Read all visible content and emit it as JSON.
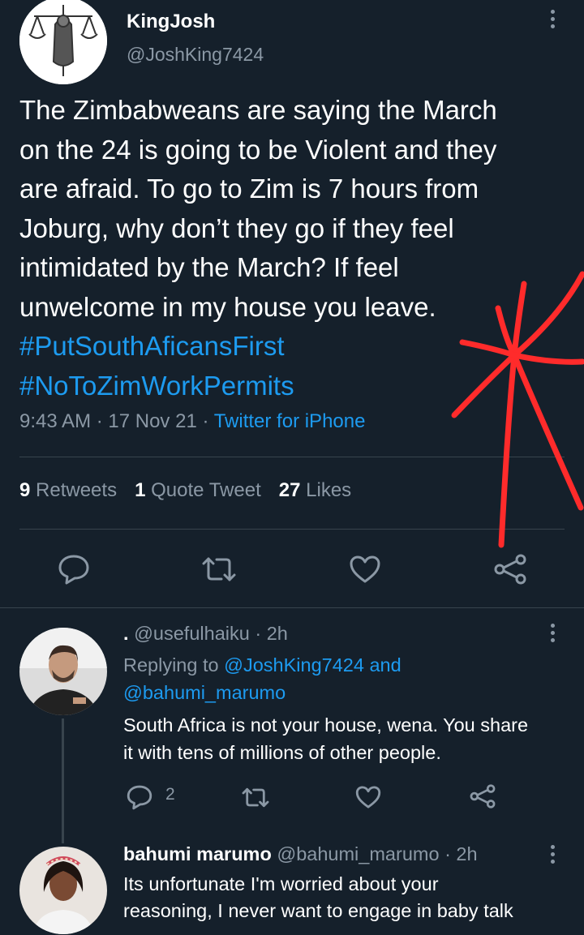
{
  "tweet": {
    "author_name": "KingJosh",
    "author_handle": "@JoshKing7424",
    "text": "The Zimbabweans are saying the March\non the 24 is going to be Violent and they\nare afraid. To go to Zim is 7 hours from\nJoburg, why don’t they go if they feel\nintimidated by the March? If feel\nunwelcome in my house you leave.",
    "hashtags": [
      "#PutSouthAficansFirst",
      "#NoToZimWorkPermits"
    ],
    "time": "9:43 AM",
    "date": "17 Nov 21",
    "source": "Twitter for iPhone",
    "retweets_count": "9",
    "retweets_label": "Retweets",
    "quotes_count": "1",
    "quotes_label": "Quote Tweet",
    "likes_count": "27",
    "likes_label": "Likes"
  },
  "replies": [
    {
      "author_name": ".",
      "author_handle": "@usefulhaiku",
      "age": "2h",
      "replying_prefix": "Replying to",
      "replying_first": "@JoshKing7424",
      "replying_and": "and",
      "replying_second": "@bahumi_marumo",
      "lines": [
        "South Africa is not your house, wena. You share",
        "it with tens of millions of other people."
      ],
      "reply_count": "2"
    },
    {
      "author_name": "bahumi marumo",
      "author_handle": "@bahumi_marumo",
      "age": "2h",
      "lines": [
        "Its unfortunate I'm worried about your",
        "reasoning, I never want to engage in baby talk"
      ]
    }
  ],
  "icons": [
    "more-icon",
    "reply-icon",
    "retweet-icon",
    "like-icon",
    "share-icon"
  ],
  "colors": {
    "background": "#15202b",
    "accent": "#1d9bf0",
    "muted": "#8b98a5",
    "divider": "#38444d",
    "annotation": "#ff2b2b"
  }
}
